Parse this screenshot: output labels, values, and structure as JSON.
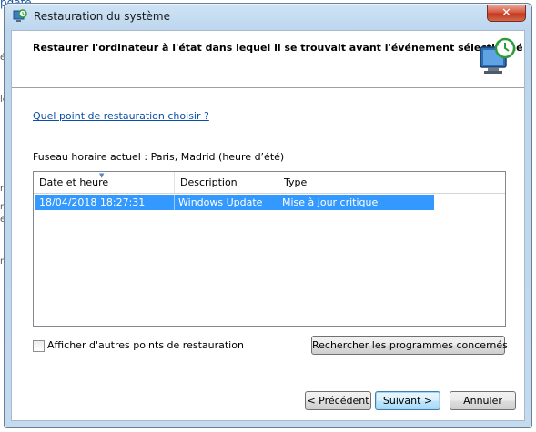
{
  "background": {
    "fragments": [
      "pdate",
      "é",
      "le",
      "ro",
      "es",
      "rc",
      "m"
    ]
  },
  "window": {
    "title": "Restauration du système",
    "close_label": "✕"
  },
  "header": {
    "text": "Restaurer l'ordinateur à l'état dans lequel il se trouvait avant l'événement sélectionné"
  },
  "help_link": "Quel point de restauration choisir ?",
  "timezone_label": "Fuseau horaire actuel : Paris, Madrid (heure d’été)",
  "list": {
    "columns": [
      "Date et heure",
      "Description",
      "Type"
    ],
    "rows": [
      {
        "date": "18/04/2018 18:27:31",
        "description": "Windows Update",
        "type": "Mise à jour critique",
        "selected": true
      }
    ]
  },
  "checkbox": {
    "label": "Afficher d'autres points de restauration",
    "checked": false
  },
  "buttons": {
    "affected": "Rechercher les programmes concernés",
    "previous": "< Précédent",
    "next": "Suivant >",
    "cancel": "Annuler"
  },
  "colors": {
    "selection": "#3399ff",
    "link": "#0b4ea8",
    "close": "#c23a20"
  }
}
